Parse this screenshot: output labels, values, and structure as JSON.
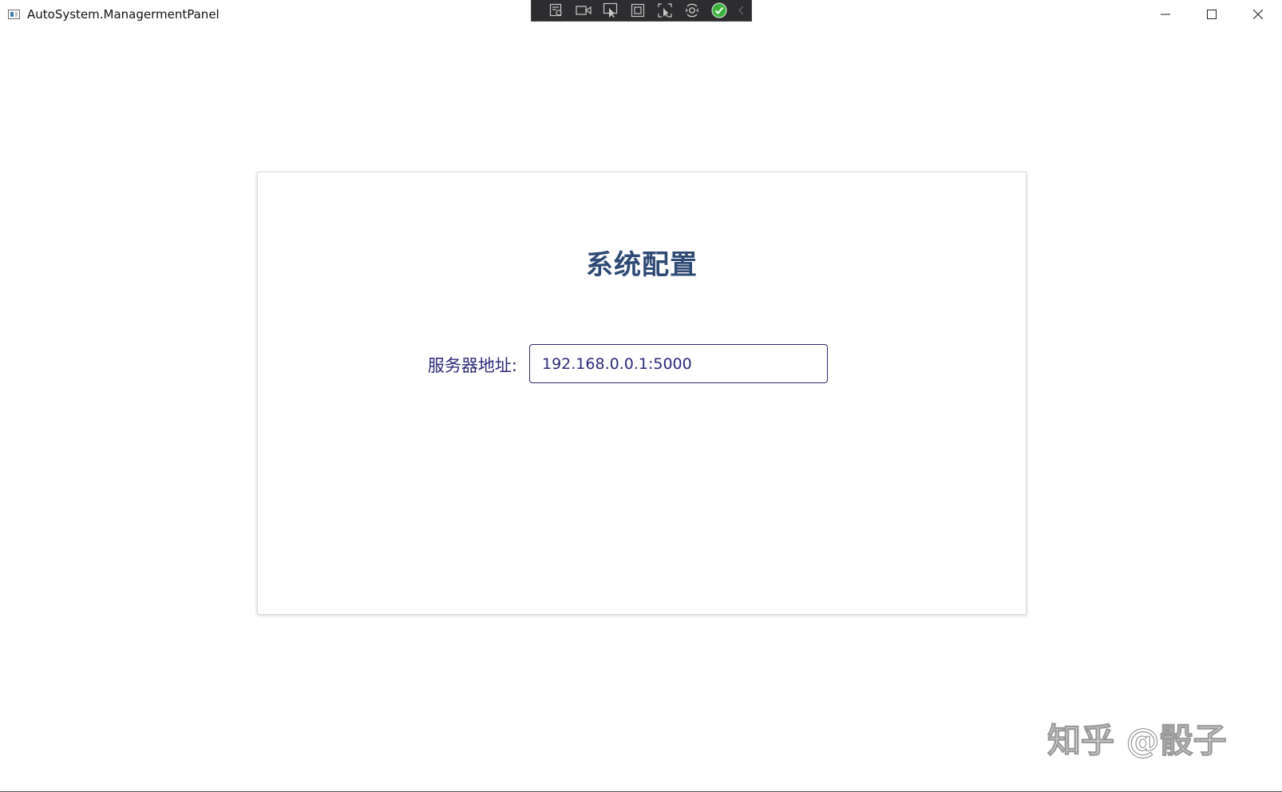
{
  "window": {
    "title": "AutoSystem.ManagermentPanel",
    "icon": "app-window-icon",
    "controls": {
      "minimize_icon": "minimize-icon",
      "maximize_icon": "maximize-icon",
      "close_icon": "close-icon"
    }
  },
  "debug_toolbar": {
    "items": [
      {
        "icon": "live-visual-tree-icon"
      },
      {
        "icon": "record-camera-icon"
      },
      {
        "icon": "select-element-icon"
      },
      {
        "icon": "display-layout-adorners-icon"
      },
      {
        "icon": "track-focus-icon"
      },
      {
        "icon": "hot-reload-icon"
      },
      {
        "icon": "binding-ok-check-icon",
        "color": "#3cb33c"
      },
      {
        "icon": "collapse-chevron-left-icon"
      }
    ]
  },
  "config_card": {
    "title": "系统配置",
    "server_address": {
      "label": "服务器地址:",
      "value": "192.168.0.0.1:5000"
    }
  },
  "watermark": {
    "text": "知乎 @骰子"
  },
  "colors": {
    "title": "#2f4a74",
    "label": "#2d2a78",
    "input_border": "#2d2a6e",
    "toolbar_bg": "#2d2d30",
    "ok_green": "#3cb33c"
  }
}
